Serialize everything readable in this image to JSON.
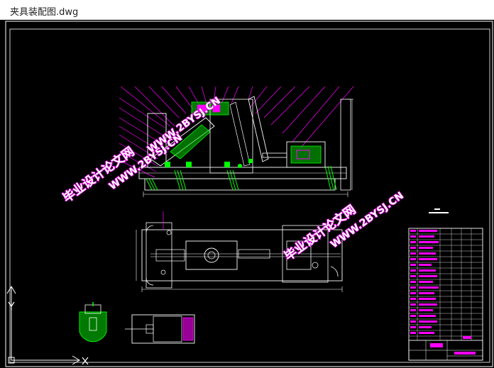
{
  "window": {
    "title": "夹具装配图.dwg"
  },
  "drawing": {
    "background_color": "#000000",
    "frame_color": "#ffffff",
    "line_color": "#ffffff",
    "leader_color": "#ff00ff",
    "hatch_color": "#00ff00",
    "part_color": "#00ff00",
    "accent_color": "#ff00ff",
    "watermarks": [
      {
        "text": "毕业设计论文网"
      },
      {
        "text": "WWW.2BYSJ.CN"
      },
      {
        "text": "毕业设计论文网"
      },
      {
        "text": "WWW.2BYSJ.CN"
      },
      {
        "text": "WWW.2BYSJ.CN"
      }
    ]
  },
  "ucs_icon": {
    "x_label": "X",
    "y_label": "Y"
  }
}
